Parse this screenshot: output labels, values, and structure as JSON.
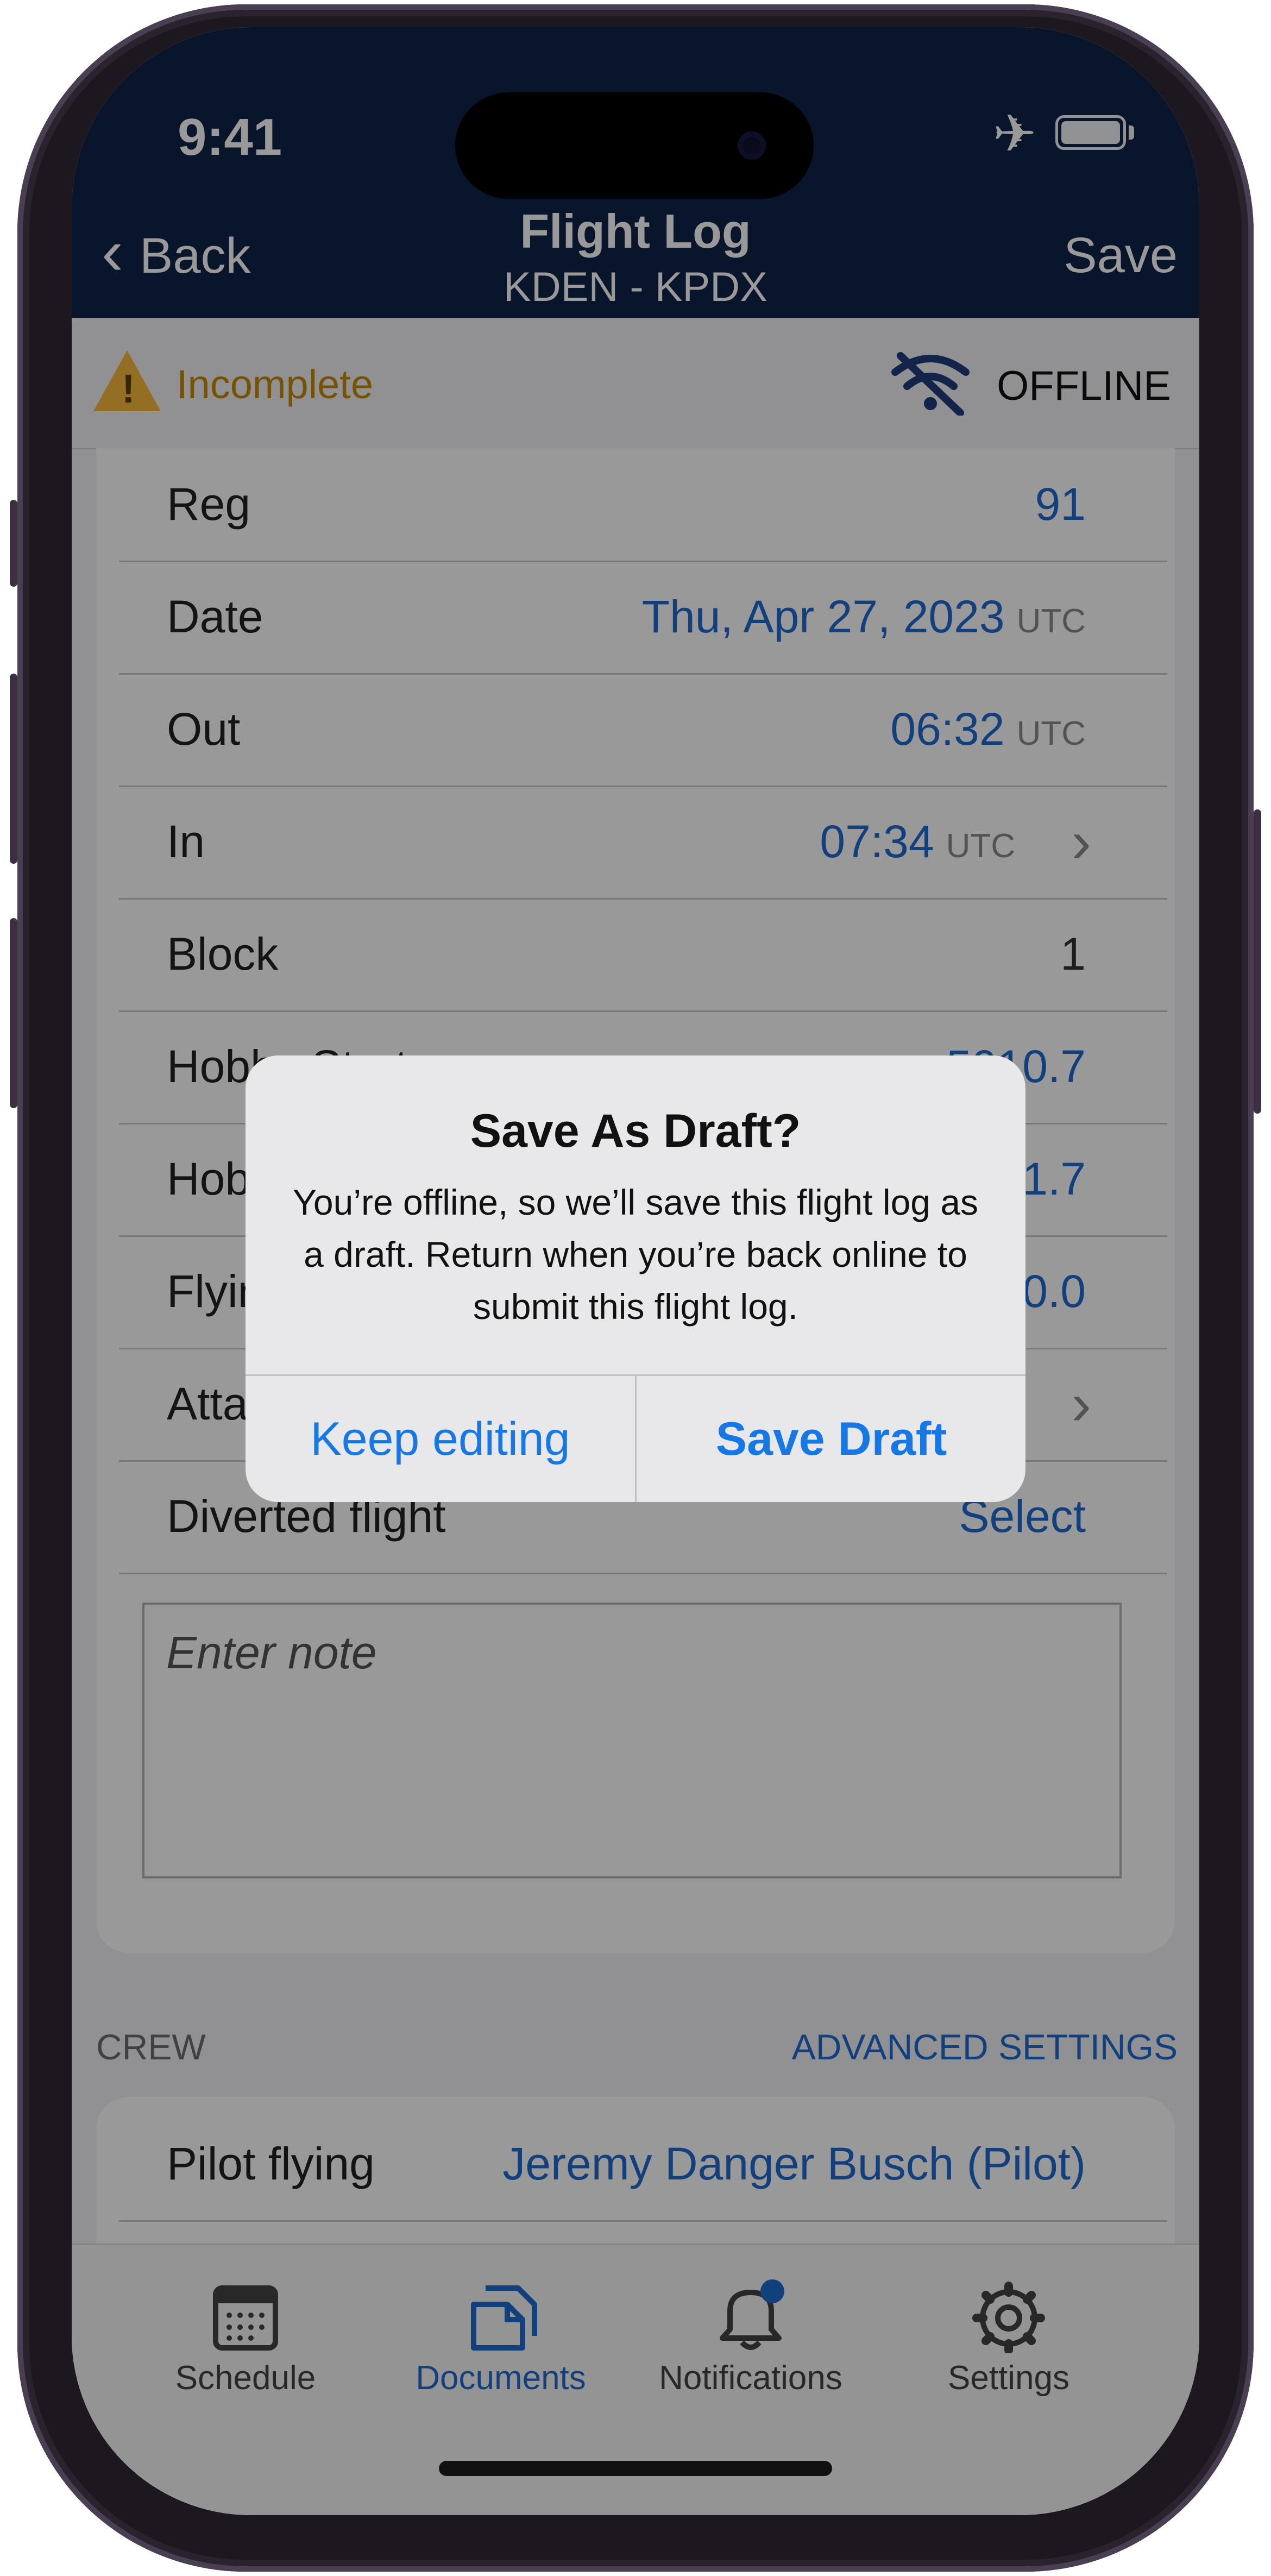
{
  "status_bar": {
    "time": "9:41"
  },
  "nav": {
    "back_label": "Back",
    "title": "Flight Log",
    "subtitle": "KDEN - KPDX",
    "save_label": "Save"
  },
  "banner": {
    "status": "Incomplete",
    "network": "OFFLINE"
  },
  "form": {
    "reg": {
      "label": "Reg",
      "value": "91"
    },
    "date": {
      "label": "Date",
      "value": "Thu, Apr 27, 2023",
      "unit": "UTC"
    },
    "out": {
      "label": "Out",
      "value": "06:32",
      "unit": "UTC"
    },
    "in": {
      "label": "In",
      "value": "07:34",
      "unit": "UTC"
    },
    "block": {
      "label": "Block",
      "value": "1"
    },
    "hobbs_start": {
      "label": "Hobbs Start",
      "value": "5010.7"
    },
    "hobbs_end": {
      "label": "Hobbs End",
      "value": "5011.7"
    },
    "flying": {
      "label": "Flying",
      "value": "0.0"
    },
    "attachments": {
      "label": "Attachments"
    },
    "diverted": {
      "label": "Diverted flight",
      "value": "Select"
    },
    "note_placeholder": "Enter note"
  },
  "crew": {
    "header": "CREW",
    "advanced": "ADVANCED SETTINGS",
    "pilot_flying": {
      "label": "Pilot flying",
      "value": "Jeremy Danger Busch (Pilot)"
    }
  },
  "tabs": [
    {
      "label": "Schedule",
      "icon": "calendar-icon"
    },
    {
      "label": "Documents",
      "icon": "documents-icon",
      "active": true
    },
    {
      "label": "Notifications",
      "icon": "bell-icon"
    },
    {
      "label": "Settings",
      "icon": "gear-icon"
    }
  ],
  "alert": {
    "title": "Save As Draft?",
    "message": "You’re offline, so we’ll save this flight log as a draft. Return when you’re back online to submit this flight log.",
    "cancel": "Keep editing",
    "confirm": "Save Draft"
  },
  "colors": {
    "header_bg": "#0f2446",
    "accent": "#1f6bd1",
    "warning": "#f7b73a",
    "notification_dot": "#1f6bd1"
  }
}
